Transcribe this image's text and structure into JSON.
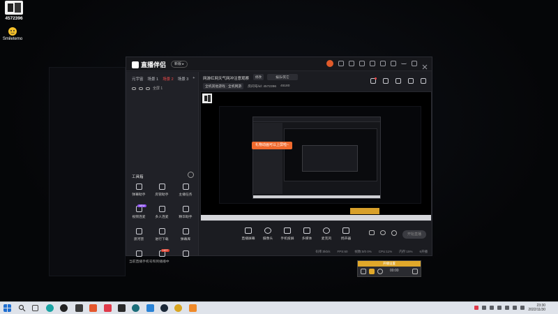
{
  "desktop": {
    "icons": [
      {
        "label": "4572396",
        "icon": "app-logo-icon"
      },
      {
        "label": "Smiletemo",
        "icon": "emoji-face-icon"
      }
    ]
  },
  "window": {
    "app_name": "直播伴侣",
    "version_badge": "新版 ▸",
    "scene_tabs": [
      "元宇宙",
      "场景 1",
      "场景 2",
      "场景 3",
      "+"
    ],
    "active_tab_index": 2,
    "source_item": "全屏 1",
    "stream_title": "网游红网天气网冲注意观察",
    "edit_label": "修改",
    "category_label": "娱乐/其它",
    "tag_label": "全机其他游戏 · 全机网游",
    "room_id_label": "房间号/id: 4572396",
    "fans_label": "45180",
    "tools_title": "工具箱",
    "tools": [
      {
        "label": "弹幕助手",
        "icon": "danmaku-icon",
        "badge": ""
      },
      {
        "label": "房管助手",
        "icon": "user-manage-icon",
        "badge": ""
      },
      {
        "label": "主播任务",
        "icon": "task-icon",
        "badge": ""
      },
      {
        "label": "视频连麦",
        "icon": "video-link-icon",
        "badge": "NEW"
      },
      {
        "label": "多人连麦",
        "icon": "multi-link-icon",
        "badge": ""
      },
      {
        "label": "精华助手",
        "icon": "highlight-icon",
        "badge": ""
      },
      {
        "label": "渡河营",
        "icon": "screen-icon",
        "badge": ""
      },
      {
        "label": "进行下载",
        "icon": "download-icon",
        "badge": ""
      },
      {
        "label": "弹幕库",
        "icon": "calendar-icon",
        "badge": ""
      },
      {
        "label": "",
        "icon": "box-icon",
        "badge": ""
      },
      {
        "label": "",
        "icon": "gift-icon",
        "badge": "HOT"
      },
      {
        "label": "",
        "icon": "download2-icon",
        "badge": ""
      }
    ],
    "sidebar_footer": "当前直播手机号和到播播中",
    "preview_toast": "礼物动画可以上屏啦~",
    "controls": [
      {
        "label": "直播屏幕",
        "icon": "screen-share-icon"
      },
      {
        "label": "摄像头",
        "icon": "camera-icon"
      },
      {
        "label": "手机投屏",
        "icon": "phone-cast-icon"
      },
      {
        "label": "多媒体",
        "icon": "media-icon"
      },
      {
        "label": "麦克风",
        "icon": "microphone-icon"
      },
      {
        "label": "扬声器",
        "icon": "speaker-icon"
      }
    ],
    "go_live_label": "开始直播",
    "status": [
      "码率:0kb/s",
      "FPS:60",
      "帧数:0/0 0%",
      "CPU:11%",
      "内存:15%",
      "6开播"
    ]
  },
  "mini_panel": {
    "title": "开播设置",
    "time": "00:00"
  },
  "taskbar": {
    "time": "23:30",
    "date": "2022/11/30"
  },
  "colors": {
    "accent_red": "#f24b4b",
    "toast_orange": "#f06a2e",
    "mini_yellow": "#e0a82a"
  }
}
